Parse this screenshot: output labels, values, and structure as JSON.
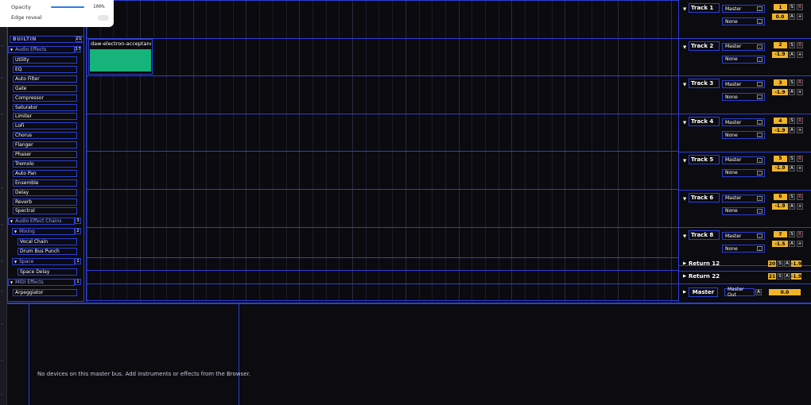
{
  "overlay": {
    "opacity_label": "Opacity",
    "opacity_value": "100%",
    "edge_reveal_label": "Edge reveal"
  },
  "browser": {
    "header": "BUILTIN",
    "header_count": "21",
    "audio_effects": {
      "label": "Audio Effects",
      "count": "17",
      "items": [
        "Utility",
        "EQ",
        "Auto Filter",
        "Gate",
        "Compressor",
        "Saturator",
        "Limiter",
        "LoFi",
        "Chorus",
        "Flanger",
        "Phaser",
        "Tremolo",
        "Auto Pan",
        "Ensemble",
        "Delay",
        "Reverb",
        "Spectral"
      ]
    },
    "audio_effect_chains": {
      "label": "Audio Effect Chains",
      "count": "3"
    },
    "mixing": {
      "label": "Mixing",
      "count": "2",
      "items": [
        "Vocal Chain",
        "Drum Bus Punch"
      ]
    },
    "space": {
      "label": "Space",
      "count": "1",
      "items": [
        "Space Delay"
      ]
    },
    "midi_effects": {
      "label": "MIDI Effects",
      "count": "1",
      "items": [
        "Arpeggiator"
      ]
    }
  },
  "clip": {
    "label": "daw-electron-acceptanc..."
  },
  "tracks": [
    {
      "name": "Track 1",
      "output": "Master",
      "input": "None",
      "number": "1",
      "volume": "0.0"
    },
    {
      "name": "Track 2",
      "output": "Master",
      "input": "None",
      "number": "2",
      "volume": "-1.9"
    },
    {
      "name": "Track 3",
      "output": "Master",
      "input": "None",
      "number": "3",
      "volume": "-1.9"
    },
    {
      "name": "Track 4",
      "output": "Master",
      "input": "None",
      "number": "4",
      "volume": "-1.9"
    },
    {
      "name": "Track 5",
      "output": "Master",
      "input": "None",
      "number": "5",
      "volume": "-1.9"
    },
    {
      "name": "Track 6",
      "output": "Master",
      "input": "None",
      "number": "6",
      "volume": "-1.9"
    },
    {
      "name": "Track 8",
      "output": "Master",
      "input": "None",
      "number": "7",
      "volume": "-1.5"
    }
  ],
  "returns": [
    {
      "name": "Return 12",
      "number": "20",
      "volume": "-1.9"
    },
    {
      "name": "Return 22",
      "number": "21",
      "volume": "-1.9"
    }
  ],
  "master": {
    "name": "Master",
    "output": "Master Out",
    "volume": "0.0"
  },
  "buttons": {
    "solo": "S",
    "record": "R",
    "arm": "A",
    "add": "+"
  },
  "device_panel": {
    "empty_message": "No devices on this master bus. Add instruments or effects from the Browser."
  },
  "icons": {
    "collapse": "triangle-down-icon",
    "expand": "triangle-right-icon"
  },
  "colors": {
    "accent": "#2b3fd6",
    "badge": "#f0b429",
    "clip": "#16b37a"
  }
}
